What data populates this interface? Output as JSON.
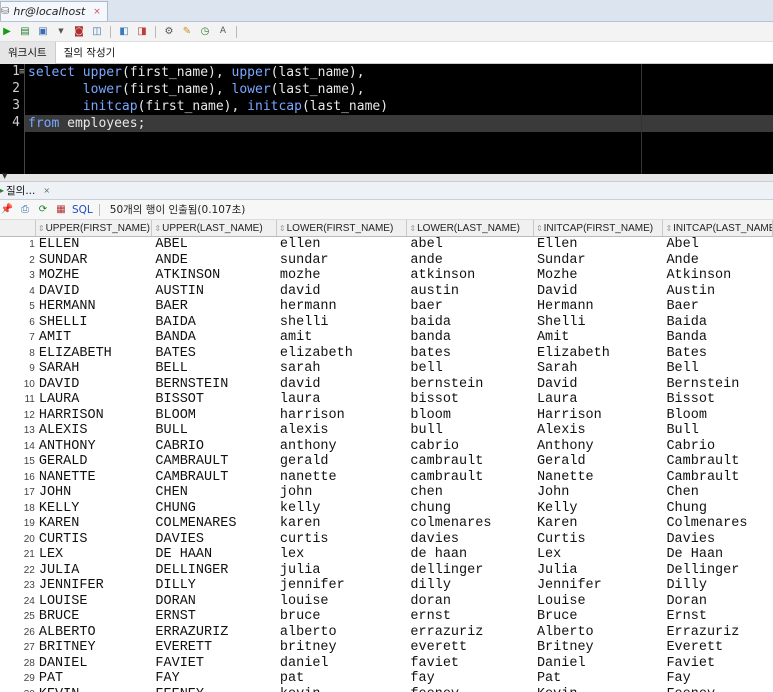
{
  "connection_tab": {
    "label": "hr@localhost",
    "close": "×"
  },
  "editor_tabs": [
    "워크시트",
    "질의 작성기"
  ],
  "editor": {
    "line_numbers": [
      "1",
      "2",
      "3",
      "4"
    ],
    "lines": [
      "select upper(first_name), upper(last_name),",
      "       lower(first_name), lower(last_name),",
      "       initcap(first_name), initcap(last_name)",
      "from employees;"
    ]
  },
  "result_tab": {
    "label": "질의...",
    "close": "×"
  },
  "result_toolbar": {
    "sql_label": "SQL",
    "status": "50개의 행이 인출됨(0.107초)"
  },
  "columns": [
    "UPPER(FIRST_NAME)",
    "UPPER(LAST_NAME)",
    "LOWER(FIRST_NAME)",
    "LOWER(LAST_NAME)",
    "INITCAP(FIRST_NAME)",
    "INITCAP(LAST_NAME)"
  ],
  "rows": [
    [
      "1",
      "ELLEN",
      "ABEL",
      "ellen",
      "abel",
      "Ellen",
      "Abel"
    ],
    [
      "2",
      "SUNDAR",
      "ANDE",
      "sundar",
      "ande",
      "Sundar",
      "Ande"
    ],
    [
      "3",
      "MOZHE",
      "ATKINSON",
      "mozhe",
      "atkinson",
      "Mozhe",
      "Atkinson"
    ],
    [
      "4",
      "DAVID",
      "AUSTIN",
      "david",
      "austin",
      "David",
      "Austin"
    ],
    [
      "5",
      "HERMANN",
      "BAER",
      "hermann",
      "baer",
      "Hermann",
      "Baer"
    ],
    [
      "6",
      "SHELLI",
      "BAIDA",
      "shelli",
      "baida",
      "Shelli",
      "Baida"
    ],
    [
      "7",
      "AMIT",
      "BANDA",
      "amit",
      "banda",
      "Amit",
      "Banda"
    ],
    [
      "8",
      "ELIZABETH",
      "BATES",
      "elizabeth",
      "bates",
      "Elizabeth",
      "Bates"
    ],
    [
      "9",
      "SARAH",
      "BELL",
      "sarah",
      "bell",
      "Sarah",
      "Bell"
    ],
    [
      "10",
      "DAVID",
      "BERNSTEIN",
      "david",
      "bernstein",
      "David",
      "Bernstein"
    ],
    [
      "11",
      "LAURA",
      "BISSOT",
      "laura",
      "bissot",
      "Laura",
      "Bissot"
    ],
    [
      "12",
      "HARRISON",
      "BLOOM",
      "harrison",
      "bloom",
      "Harrison",
      "Bloom"
    ],
    [
      "13",
      "ALEXIS",
      "BULL",
      "alexis",
      "bull",
      "Alexis",
      "Bull"
    ],
    [
      "14",
      "ANTHONY",
      "CABRIO",
      "anthony",
      "cabrio",
      "Anthony",
      "Cabrio"
    ],
    [
      "15",
      "GERALD",
      "CAMBRAULT",
      "gerald",
      "cambrault",
      "Gerald",
      "Cambrault"
    ],
    [
      "16",
      "NANETTE",
      "CAMBRAULT",
      "nanette",
      "cambrault",
      "Nanette",
      "Cambrault"
    ],
    [
      "17",
      "JOHN",
      "CHEN",
      "john",
      "chen",
      "John",
      "Chen"
    ],
    [
      "18",
      "KELLY",
      "CHUNG",
      "kelly",
      "chung",
      "Kelly",
      "Chung"
    ],
    [
      "19",
      "KAREN",
      "COLMENARES",
      "karen",
      "colmenares",
      "Karen",
      "Colmenares"
    ],
    [
      "20",
      "CURTIS",
      "DAVIES",
      "curtis",
      "davies",
      "Curtis",
      "Davies"
    ],
    [
      "21",
      "LEX",
      "DE HAAN",
      "lex",
      "de haan",
      "Lex",
      "De Haan"
    ],
    [
      "22",
      "JULIA",
      "DELLINGER",
      "julia",
      "dellinger",
      "Julia",
      "Dellinger"
    ],
    [
      "23",
      "JENNIFER",
      "DILLY",
      "jennifer",
      "dilly",
      "Jennifer",
      "Dilly"
    ],
    [
      "24",
      "LOUISE",
      "DORAN",
      "louise",
      "doran",
      "Louise",
      "Doran"
    ],
    [
      "25",
      "BRUCE",
      "ERNST",
      "bruce",
      "ernst",
      "Bruce",
      "Ernst"
    ],
    [
      "26",
      "ALBERTO",
      "ERRAZURIZ",
      "alberto",
      "errazuriz",
      "Alberto",
      "Errazuriz"
    ],
    [
      "27",
      "BRITNEY",
      "EVERETT",
      "britney",
      "everett",
      "Britney",
      "Everett"
    ],
    [
      "28",
      "DANIEL",
      "FAVIET",
      "daniel",
      "faviet",
      "Daniel",
      "Faviet"
    ],
    [
      "29",
      "PAT",
      "FAY",
      "pat",
      "fay",
      "Pat",
      "Fay"
    ],
    [
      "30",
      "KEVIN",
      "FEENEY",
      "kevin",
      "feeney",
      "Kevin",
      "Feeney"
    ]
  ]
}
